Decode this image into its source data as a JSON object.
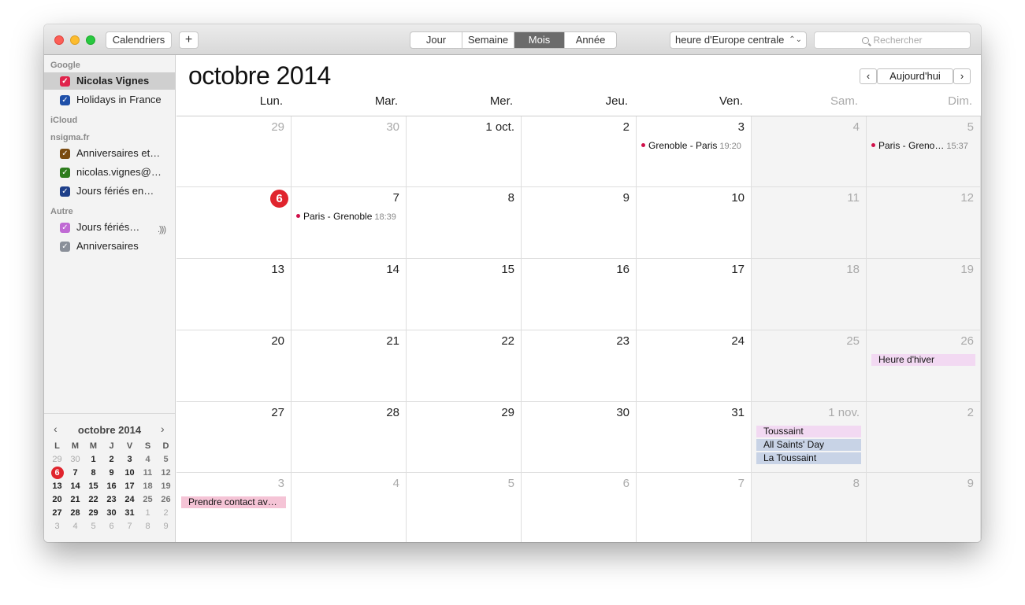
{
  "toolbar": {
    "calendars_button": "Calendriers",
    "add_button": "+",
    "views": [
      {
        "label": "Jour",
        "active": false
      },
      {
        "label": "Semaine",
        "active": false
      },
      {
        "label": "Mois",
        "active": true
      },
      {
        "label": "Année",
        "active": false
      }
    ],
    "timezone": "heure d'Europe centrale",
    "search_placeholder": "Rechercher"
  },
  "sidebar": {
    "groups": [
      {
        "name": "Google",
        "items": [
          {
            "label": "Nicolas Vignes",
            "color": "#e0244c",
            "selected": true
          },
          {
            "label": "Holidays in France",
            "color": "#1e4fa8",
            "selected": false
          }
        ]
      },
      {
        "name": "iCloud",
        "items": []
      },
      {
        "name": "nsigma.fr",
        "items": [
          {
            "label": "Anniversaires et…",
            "color": "#7a4a10",
            "selected": false
          },
          {
            "label": "nicolas.vignes@…",
            "color": "#2e7d1e",
            "selected": false
          },
          {
            "label": "Jours fériés en…",
            "color": "#1e3f8a",
            "selected": false
          }
        ]
      },
      {
        "name": "Autre",
        "items": [
          {
            "label": "Jours fériés…",
            "color": "#c06ad4",
            "selected": false,
            "icon": "subscription-icon"
          },
          {
            "label": "Anniversaires",
            "color": "#8a8f99",
            "selected": false
          }
        ]
      }
    ]
  },
  "mini_calendar": {
    "title": "octobre 2014",
    "prev": "‹",
    "next": "›",
    "headers": [
      "L",
      "M",
      "M",
      "J",
      "V",
      "S",
      "D"
    ],
    "weeks": [
      [
        "29",
        "30",
        "1",
        "2",
        "3",
        "4",
        "5"
      ],
      [
        "6",
        "7",
        "8",
        "9",
        "10",
        "11",
        "12"
      ],
      [
        "13",
        "14",
        "15",
        "16",
        "17",
        "18",
        "19"
      ],
      [
        "20",
        "21",
        "22",
        "23",
        "24",
        "25",
        "26"
      ],
      [
        "27",
        "28",
        "29",
        "30",
        "31",
        "1",
        "2"
      ],
      [
        "3",
        "4",
        "5",
        "6",
        "7",
        "8",
        "9"
      ]
    ]
  },
  "main": {
    "title": "octobre 2014",
    "prev": "‹",
    "today_button": "Aujourd'hui",
    "next": "›",
    "weekdays": [
      "Lun.",
      "Mar.",
      "Mer.",
      "Jeu.",
      "Ven.",
      "Sam.",
      "Dim."
    ],
    "weeks": [
      [
        {
          "label": "29",
          "dim": true
        },
        {
          "label": "30",
          "dim": true
        },
        {
          "label": "1 oct."
        },
        {
          "label": "2"
        },
        {
          "label": "3",
          "events": [
            {
              "type": "dot",
              "title": "Grenoble - Paris",
              "time": "19:20",
              "color": "#d0104a"
            }
          ]
        },
        {
          "label": "4"
        },
        {
          "label": "5",
          "events": [
            {
              "type": "dot",
              "title": "Paris - Greno…",
              "time": "15:37",
              "color": "#d0104a"
            }
          ]
        }
      ],
      [
        {
          "label": "6",
          "today": true
        },
        {
          "label": "7",
          "events": [
            {
              "type": "dot",
              "title": "Paris - Grenoble",
              "time": "18:39",
              "color": "#d0104a"
            }
          ]
        },
        {
          "label": "8"
        },
        {
          "label": "9"
        },
        {
          "label": "10"
        },
        {
          "label": "11"
        },
        {
          "label": "12"
        }
      ],
      [
        {
          "label": "13"
        },
        {
          "label": "14"
        },
        {
          "label": "15"
        },
        {
          "label": "16"
        },
        {
          "label": "17"
        },
        {
          "label": "18"
        },
        {
          "label": "19"
        }
      ],
      [
        {
          "label": "20"
        },
        {
          "label": "21"
        },
        {
          "label": "22"
        },
        {
          "label": "23"
        },
        {
          "label": "24"
        },
        {
          "label": "25"
        },
        {
          "label": "26",
          "events": [
            {
              "type": "bar",
              "title": "Heure d'hiver",
              "color": "#f2d9f2"
            }
          ]
        }
      ],
      [
        {
          "label": "27"
        },
        {
          "label": "28"
        },
        {
          "label": "29"
        },
        {
          "label": "30"
        },
        {
          "label": "31"
        },
        {
          "label": "1 nov.",
          "dim": true,
          "events": [
            {
              "type": "bar",
              "title": "Toussaint",
              "color": "#f2d9f2"
            },
            {
              "type": "bar",
              "title": "All Saints' Day",
              "color": "#c8d3e6"
            },
            {
              "type": "bar",
              "title": "La Toussaint",
              "color": "#c8d3e6"
            }
          ]
        },
        {
          "label": "2",
          "dim": true
        }
      ],
      [
        {
          "label": "3",
          "dim": true,
          "events": [
            {
              "type": "bar",
              "title": "Prendre contact av…",
              "color": "#f5c4d6"
            }
          ]
        },
        {
          "label": "4",
          "dim": true
        },
        {
          "label": "5",
          "dim": true
        },
        {
          "label": "6",
          "dim": true
        },
        {
          "label": "7",
          "dim": true
        },
        {
          "label": "8",
          "dim": true
        },
        {
          "label": "9",
          "dim": true
        }
      ]
    ]
  }
}
